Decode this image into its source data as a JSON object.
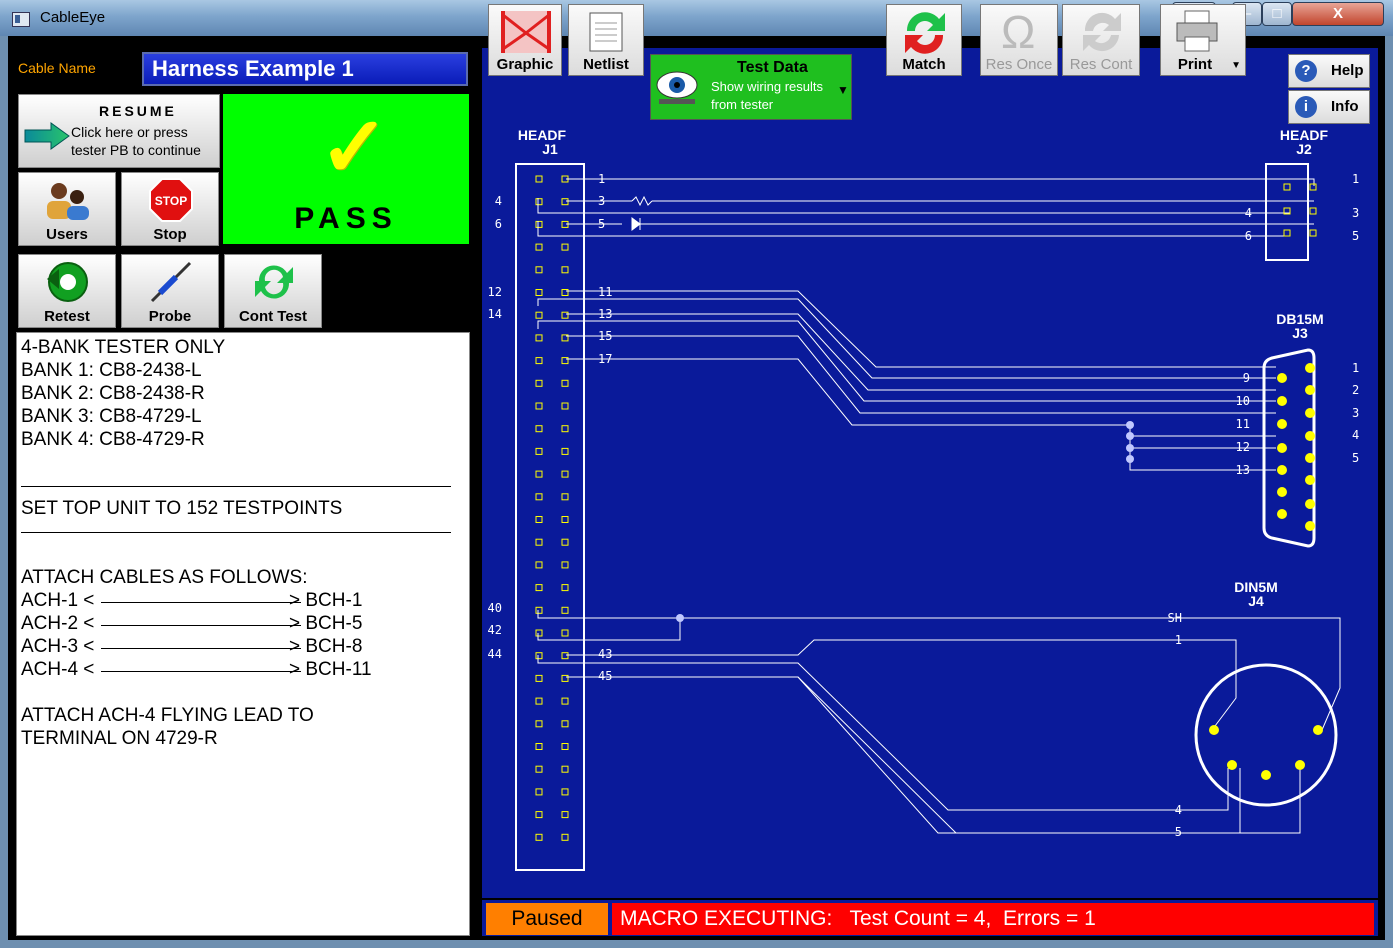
{
  "window": {
    "title": "CableEye",
    "restore_glyph": "⇔",
    "min_glyph": "–",
    "max_glyph": "□",
    "close_glyph": "X"
  },
  "cable": {
    "label": "Cable Name",
    "value": "Harness Example 1"
  },
  "resume": {
    "title": "RESUME",
    "line1": "Click here or press",
    "line2": "tester PB to continue"
  },
  "result": {
    "check": "✓",
    "text": "PASS"
  },
  "buttons": {
    "users": "Users",
    "stop": "Stop",
    "stop_sign": "STOP",
    "retest": "Retest",
    "probe": "Probe",
    "cont_test": "Cont Test"
  },
  "notes": {
    "l1": "4-BANK TESTER ONLY",
    "l2": "BANK 1: CB8-2438-L",
    "l3": "BANK 2: CB8-2438-R",
    "l4": "BANK 3: CB8-4729-L",
    "l5": "BANK 4: CB8-4729-R",
    "l6": "SET TOP UNIT TO 152 TESTPOINTS",
    "l7": "ATTACH CABLES AS FOLLOWS:",
    "a1l": "ACH-1 <",
    "a1r": "> BCH-1",
    "a2l": "ACH-2 <",
    "a2r": "> BCH-5",
    "a3l": "ACH-3 <",
    "a3r": "> BCH-8",
    "a4l": "ACH-4 <",
    "a4r": "> BCH-11",
    "l8": "ATTACH ACH-4 FLYING LEAD TO",
    "l9": "TERMINAL ON 4729-R"
  },
  "toolbar": {
    "graphic": "Graphic",
    "netlist": "Netlist",
    "testdata_title": "Test Data",
    "testdata_l1": "Show wiring results",
    "testdata_l2": "from tester",
    "match": "Match",
    "res_once": "Res Once",
    "res_cont": "Res Cont",
    "print": "Print",
    "help": "Help",
    "info": "Info"
  },
  "diagram": {
    "j1_type": "HEADF",
    "j1_name": "J1",
    "j2_type": "HEADF",
    "j2_name": "J2",
    "j3_type": "DB15M",
    "j3_name": "J3",
    "j4_type": "DIN5M",
    "j4_name": "J4",
    "left_pins": [
      "4",
      "6",
      "12",
      "14",
      "40",
      "42",
      "44"
    ],
    "j1_wire_labels": [
      "1",
      "3",
      "5",
      "11",
      "13",
      "15",
      "17",
      "43",
      "45"
    ],
    "j2_in_labels": [
      "4",
      "6"
    ],
    "j2_pins": [
      "1",
      "3",
      "5"
    ],
    "j3_in_labels": [
      "9",
      "10",
      "11",
      "12",
      "13"
    ],
    "j3_pins": [
      "1",
      "2",
      "3",
      "4",
      "5"
    ],
    "j4_in_labels": [
      "SH",
      "1",
      "4",
      "5"
    ]
  },
  "status": {
    "state": "Paused",
    "message": "MACRO EXECUTING:   Test Count = 4,  Errors = 1"
  },
  "colors": {
    "canvas": "#0a1a9a",
    "pass": "#00ff00",
    "paused": "#ff7f00",
    "macro": "#ff0000",
    "pin": "#ffff00"
  }
}
